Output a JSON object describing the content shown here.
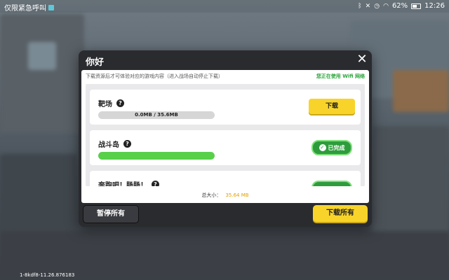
{
  "status_bar": {
    "left_text": "仅限紧急呼叫",
    "battery_percent": "62%",
    "time": "12:26",
    "icons": [
      "bluetooth-icon",
      "mute-icon",
      "alarm-icon",
      "wifi-icon",
      "battery-icon"
    ]
  },
  "dialog": {
    "title": "你好",
    "notice": "下载资源后才可体验对应的游戏内容（进入战场自动停止下载）",
    "wifi_note": "您正在使用 Wifi 网络",
    "items": [
      {
        "name": "靶场",
        "progress_text": "0.0MB / 35.6MB",
        "progress_fraction": 0.0,
        "action_label": "下载",
        "state": "download"
      },
      {
        "name": "战斗岛",
        "progress_fraction": 1.0,
        "action_label": "已完成",
        "state": "done"
      },
      {
        "name": "奔跑吧！肠肠！",
        "state": "done"
      }
    ],
    "total_label": "总大小：",
    "total_size": "35.64 MB",
    "pause_all_label": "暂停所有",
    "download_all_label": "下载所有"
  },
  "version": "1-8kdf8-11.26.876183",
  "colors": {
    "accent_yellow": "#f8d42a",
    "done_green": "#2e9c3c",
    "progress_green": "#58d04a",
    "wifi_green": "#2aa53a"
  }
}
